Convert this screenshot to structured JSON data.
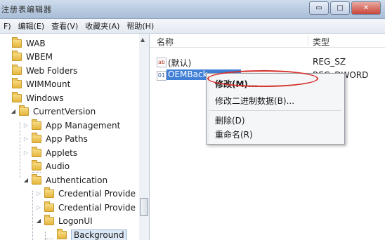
{
  "window": {
    "title": "注册表编辑器"
  },
  "window_buttons": {
    "minimize": "▭",
    "close": "✕"
  },
  "menubar": {
    "items": [
      "F) ",
      "编辑(E)",
      "查看(V)",
      "收藏夹(A)",
      "帮助(H)"
    ]
  },
  "tree": {
    "items": [
      {
        "label": "WAB",
        "level": 0,
        "state": "leaf"
      },
      {
        "label": "WBEM",
        "level": 0,
        "state": "leaf"
      },
      {
        "label": "Web Folders",
        "level": 0,
        "state": "leaf"
      },
      {
        "label": "WIMMount",
        "level": 0,
        "state": "leaf"
      },
      {
        "label": "Windows",
        "level": 0,
        "state": "leaf"
      },
      {
        "label": "CurrentVersion",
        "level": 1,
        "state": "expanded"
      },
      {
        "label": "App Management",
        "level": 2,
        "state": "collapsed"
      },
      {
        "label": "App Paths",
        "level": 2,
        "state": "collapsed"
      },
      {
        "label": "Applets",
        "level": 2,
        "state": "collapsed"
      },
      {
        "label": "Audio",
        "level": 2,
        "state": "leaf"
      },
      {
        "label": "Authentication",
        "level": 2,
        "state": "expanded"
      },
      {
        "label": "Credential Provide",
        "level": 3,
        "state": "collapsed"
      },
      {
        "label": "Credential Provide",
        "level": 3,
        "state": "collapsed"
      },
      {
        "label": "LogonUI",
        "level": 3,
        "state": "expanded"
      },
      {
        "label": "Background",
        "level": 4,
        "state": "selected"
      }
    ]
  },
  "list": {
    "columns": {
      "name": "名称",
      "type": "类型"
    },
    "rows": [
      {
        "icon": "ab",
        "name": "(默认)",
        "type": "REG_SZ"
      },
      {
        "icon": "dw",
        "name": "OEMBack",
        "type": "REG_DWORD"
      }
    ]
  },
  "context_menu": {
    "items": [
      "修改(M)...",
      "修改二进制数据(B)...",
      "删除(D)",
      "重命名(R)"
    ]
  },
  "colors": {
    "highlight_oval": "#d6302a",
    "selection": "#3f7fd6"
  }
}
